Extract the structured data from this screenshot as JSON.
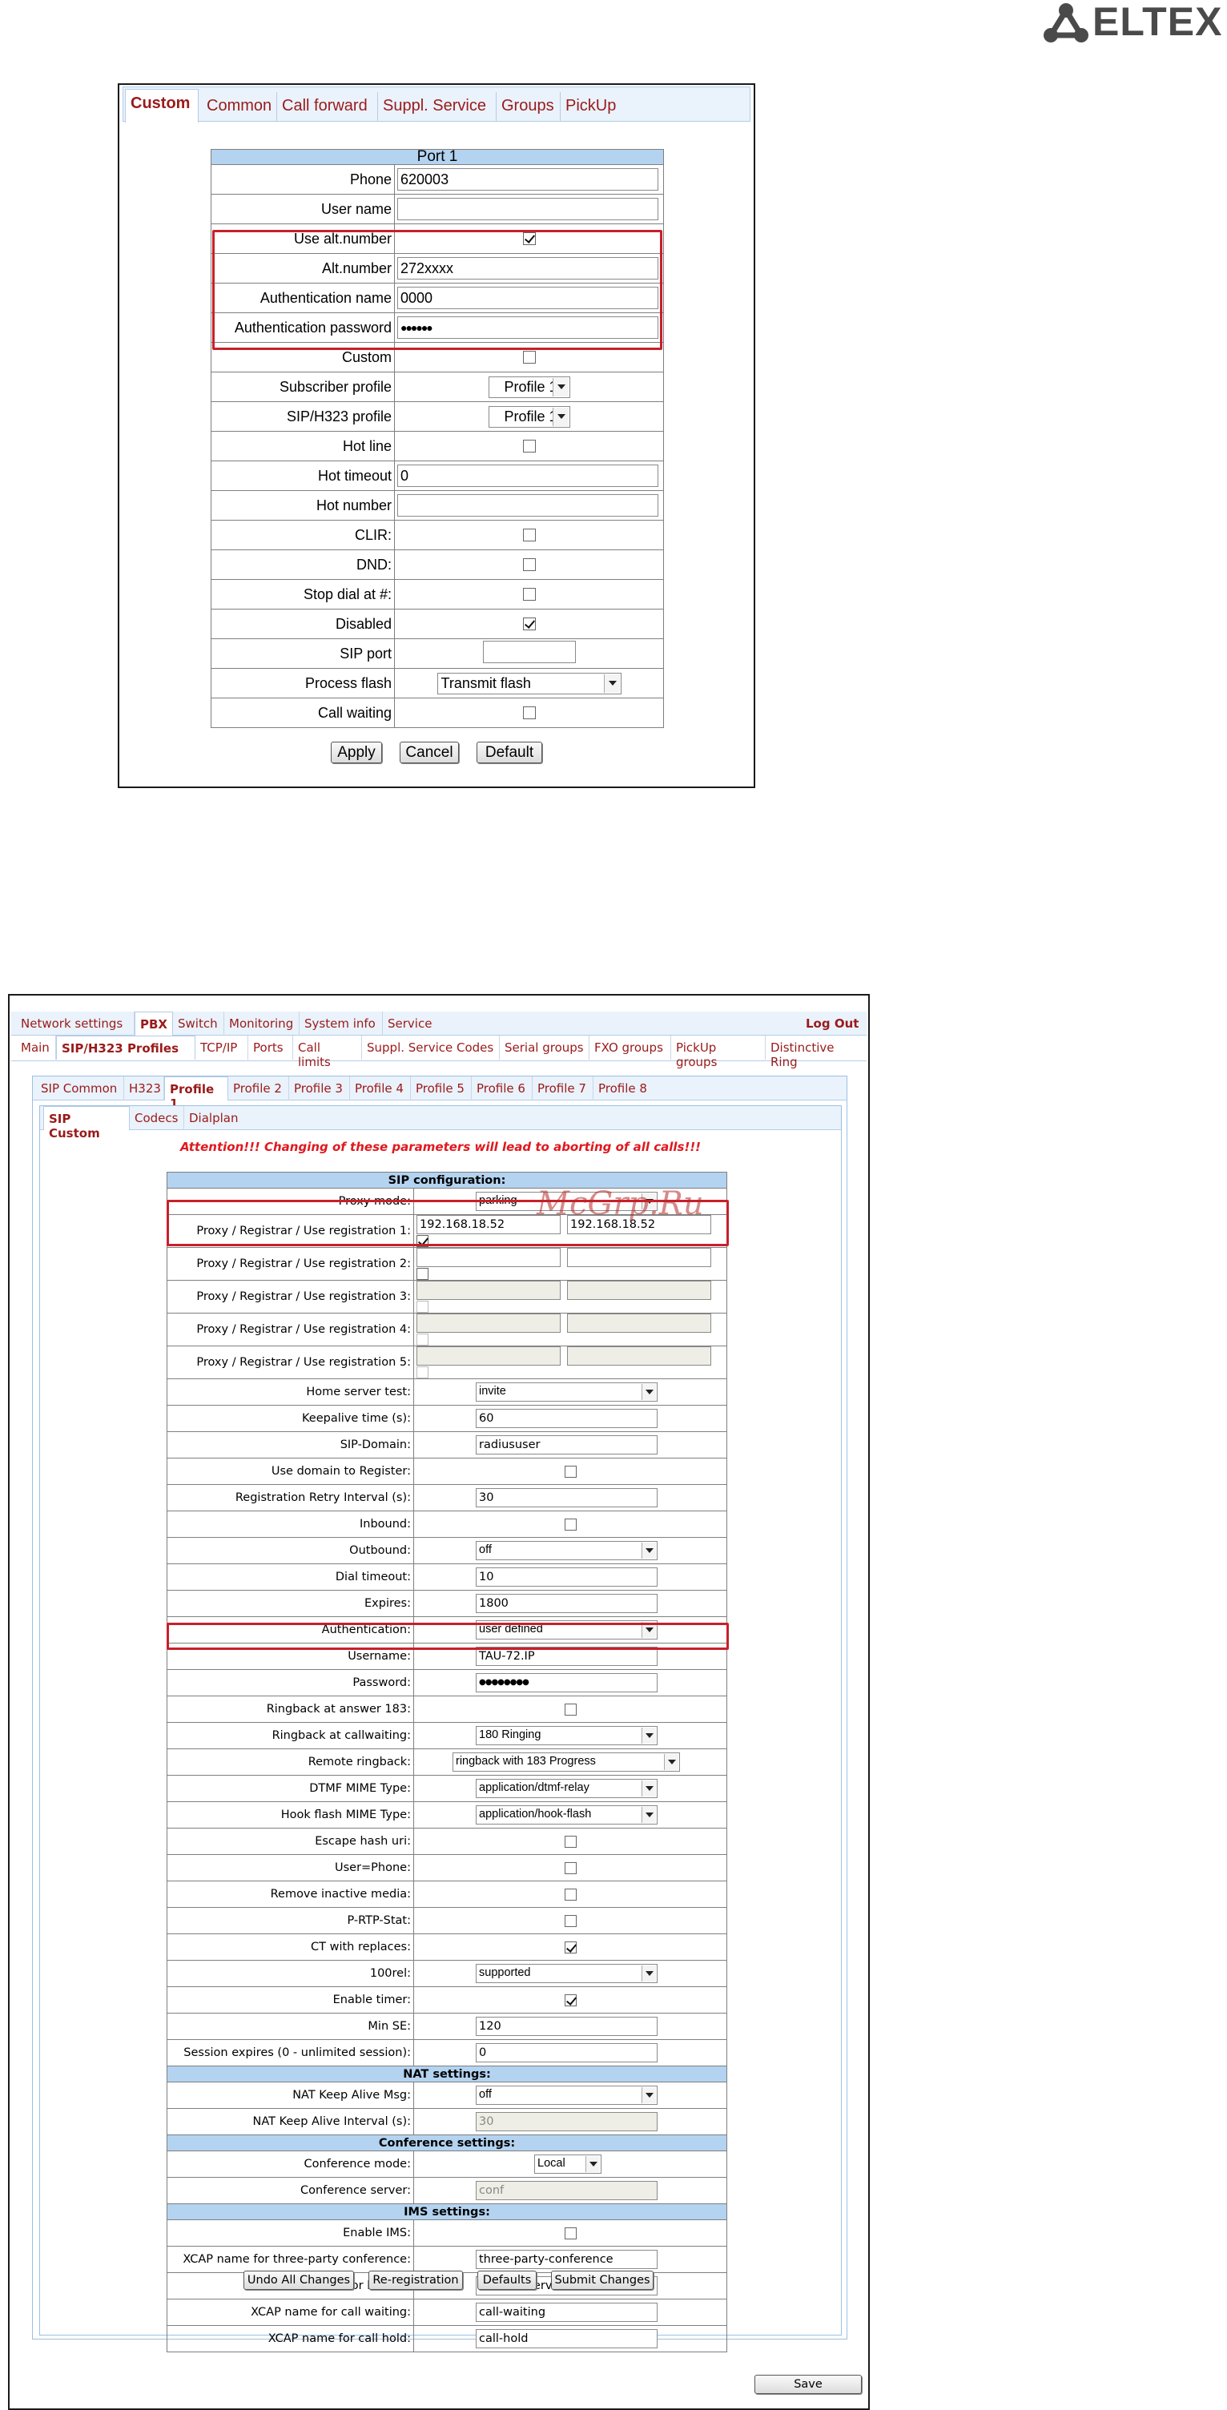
{
  "logo": {
    "text": "ELTEX",
    "icon": "eltex-logo-icon"
  },
  "port_panel": {
    "tabs": [
      "Custom",
      "Common",
      "Call forward",
      "Suppl. Service",
      "Groups",
      "PickUp"
    ],
    "header": "Port 1",
    "rows": {
      "phone_label": "Phone",
      "phone_value": "620003",
      "username_label": "User name",
      "username_value": "",
      "use_alt_label": "Use alt.number",
      "alt_label": "Alt.number",
      "alt_value": "272xxxx",
      "auth_name_label": "Authentication name",
      "auth_name_value": "0000",
      "auth_pass_label": "Authentication password",
      "auth_pass_value": "●●●●●●",
      "custom_label": "Custom",
      "subscriber_profile_label": "Subscriber profile",
      "subscriber_profile_value": "Profile 1",
      "sip_profile_label": "SIP/H323 profile",
      "sip_profile_value": "Profile 1",
      "hotline_label": "Hot line",
      "hot_timeout_label": "Hot timeout",
      "hot_timeout_value": "0",
      "hot_number_label": "Hot number",
      "hot_number_value": "",
      "clir_label": "CLIR:",
      "dnd_label": "DND:",
      "stop_dial_label": "Stop dial at #:",
      "disabled_label": "Disabled",
      "sip_port_label": "SIP port",
      "sip_port_value": "",
      "process_flash_label": "Process flash",
      "process_flash_value": "Transmit flash",
      "call_waiting_label": "Call waiting"
    },
    "buttons": {
      "apply": "Apply",
      "cancel": "Cancel",
      "default": "Default"
    }
  },
  "pbx_panel": {
    "top_tabs": [
      "Network settings",
      "PBX",
      "Switch",
      "Monitoring",
      "System info",
      "Service"
    ],
    "logout": "Log Out",
    "sub_tabs": [
      "Main",
      "SIP/H323 Profiles",
      "TCP/IP",
      "Ports",
      "Call limits",
      "Suppl. Service Codes",
      "Serial groups",
      "FXO groups",
      "PickUp groups",
      "Distinctive Ring"
    ],
    "profile_tabs": [
      "SIP Common",
      "H323",
      "Profile 1",
      "Profile 2",
      "Profile 3",
      "Profile 4",
      "Profile 5",
      "Profile 6",
      "Profile 7",
      "Profile 8"
    ],
    "sip_tabs": [
      "SIP Custom",
      "Codecs",
      "Dialplan"
    ],
    "attention": "Attention!!! Changing of these parameters will lead to aborting of all calls!!!",
    "sip_header": "SIP configuration:",
    "proxy_mode_label": "Proxy mode:",
    "proxy_mode_value": "parking",
    "reg1_label": "Proxy / Registrar / Use registration 1:",
    "reg1_proxy": "192.168.18.52",
    "reg1_registrar": "192.168.18.52",
    "reg2_label": "Proxy / Registrar / Use registration 2:",
    "reg3_label": "Proxy / Registrar / Use registration 3:",
    "reg4_label": "Proxy / Registrar / Use registration 4:",
    "reg5_label": "Proxy / Registrar / Use registration 5:",
    "home_server_label": "Home server test:",
    "home_server_value": "invite",
    "keepalive_label": "Keepalive time (s):",
    "keepalive_value": "60",
    "sip_domain_label": "SIP-Domain:",
    "sip_domain_value": "radiususer",
    "use_domain_label": "Use domain to Register:",
    "retry_label": "Registration Retry Interval (s):",
    "retry_value": "30",
    "inbound_label": "Inbound:",
    "outbound_label": "Outbound:",
    "outbound_value": "off",
    "dial_timeout_label": "Dial timeout:",
    "dial_timeout_value": "10",
    "expires_label": "Expires:",
    "expires_value": "1800",
    "auth_label": "Authentication:",
    "auth_value": "user defined",
    "username_label": "Username:",
    "username_value": "TAU-72.IP",
    "password_label": "Password:",
    "password_value": "●●●●●●●●",
    "ringback183_label": "Ringback at answer 183:",
    "ringback_cw_label": "Ringback at callwaiting:",
    "ringback_cw_value": "180 Ringing",
    "remote_ringback_label": "Remote ringback:",
    "remote_ringback_value": "ringback with 183 Progress",
    "dtmf_label": "DTMF MIME Type:",
    "dtmf_value": "application/dtmf-relay",
    "hookflash_label": "Hook flash MIME Type:",
    "hookflash_value": "application/hook-flash",
    "escape_label": "Escape hash uri:",
    "userphone_label": "User=Phone:",
    "remove_inactive_label": "Remove inactive media:",
    "prtp_label": "P-RTP-Stat:",
    "ct_label": "CT with replaces:",
    "rel100_label": "100rel:",
    "rel100_value": "supported",
    "timer_label": "Enable timer:",
    "minse_label": "Min SE:",
    "minse_value": "120",
    "session_label": "Session expires (0 - unlimited session):",
    "session_value": "0",
    "nat_header": "NAT settings:",
    "nat_msg_label": "NAT Keep Alive Msg:",
    "nat_msg_value": "off",
    "nat_int_label": "NAT Keep Alive Interval (s):",
    "nat_int_value": "30",
    "conf_header": "Conference settings:",
    "conf_mode_label": "Conference mode:",
    "conf_mode_value": "Local",
    "conf_server_label": "Conference server:",
    "conf_server_value": "conf",
    "ims_header": "IMS settings:",
    "ims_enable_label": "Enable IMS:",
    "xcap3_label": "XCAP name for three-party conference:",
    "xcap3_value": "three-party-conference",
    "xcaphot_label": "XCAP name for hotline:",
    "xcaphot_value": "hot-line-service",
    "xcapcw_label": "XCAP name for call waiting:",
    "xcapcw_value": "call-waiting",
    "xcaphold_label": "XCAP name for call hold:",
    "xcaphold_value": "call-hold",
    "buttons": {
      "undo": "Undo All Changes",
      "rereg": "Re-registration",
      "defaults": "Defaults",
      "submit": "Submit Changes",
      "save": "Save"
    }
  },
  "watermark": "McGrp.Ru"
}
